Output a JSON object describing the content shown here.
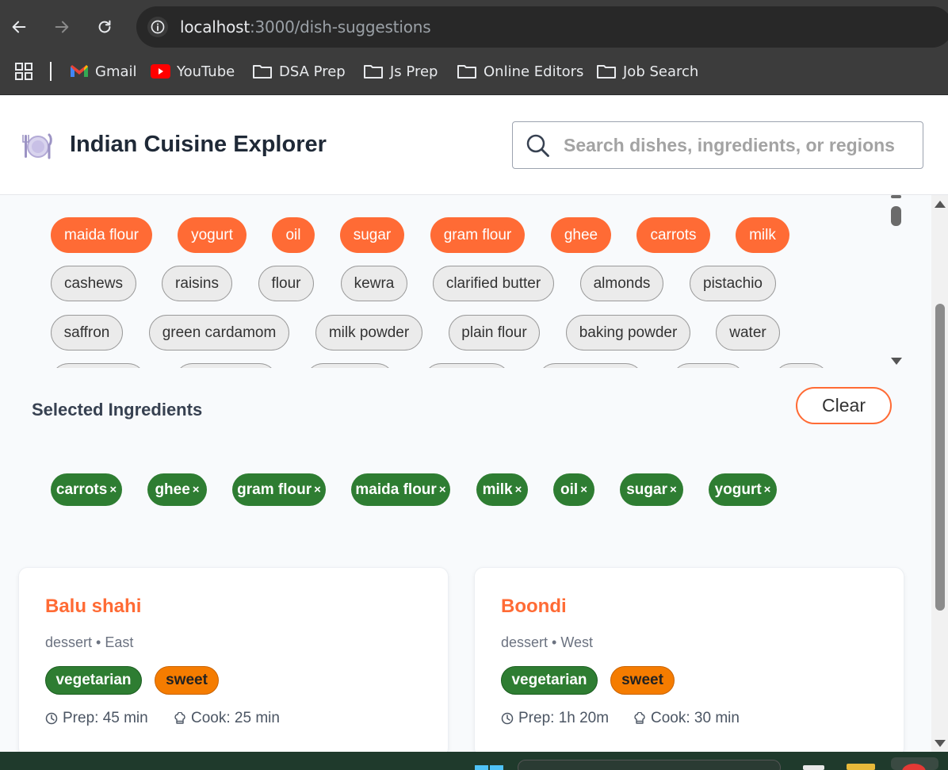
{
  "browser": {
    "url_host": "localhost",
    "url_path": ":3000/dish-suggestions",
    "bookmarks": [
      {
        "label": "Gmail",
        "icon": "gmail-icon"
      },
      {
        "label": "YouTube",
        "icon": "youtube-icon"
      },
      {
        "label": "DSA Prep",
        "icon": "folder-icon"
      },
      {
        "label": "Js Prep",
        "icon": "folder-icon"
      },
      {
        "label": "Online Editors",
        "icon": "folder-icon"
      },
      {
        "label": "Job Search",
        "icon": "folder-icon"
      }
    ]
  },
  "header": {
    "title": "Indian Cuisine Explorer",
    "logo_icon": "plate-cutlery-icon",
    "search_placeholder": "Search dishes, ingredients, or regions"
  },
  "ingredients": {
    "row1": [
      "maida flour",
      "yogurt",
      "oil",
      "sugar",
      "gram flour",
      "ghee",
      "carrots",
      "milk"
    ],
    "row2": [
      "cashews",
      "raisins",
      "flour",
      "kewra",
      "clarified butter",
      "almonds",
      "pistachio"
    ],
    "row3": [
      "saffron",
      "green cardamom",
      "milk powder",
      "plain flour",
      "baking powder",
      "water"
    ]
  },
  "selected": {
    "title": "Selected Ingredients",
    "clear_label": "Clear",
    "remove_symbol": "×",
    "tags": [
      "carrots",
      "ghee",
      "gram flour",
      "maida flour",
      "milk",
      "oil",
      "sugar",
      "yogurt"
    ]
  },
  "dishes": [
    {
      "name": "Balu shahi",
      "meta": "dessert • East",
      "badges": [
        "vegetarian",
        "sweet"
      ],
      "prep": "Prep: 45 min",
      "cook": "Cook: 25 min"
    },
    {
      "name": "Boondi",
      "meta": "dessert • West",
      "badges": [
        "vegetarian",
        "sweet"
      ],
      "prep": "Prep: 1h 20m",
      "cook": "Cook: 30 min"
    }
  ],
  "colors": {
    "accent": "#ff6b35",
    "selected_tag": "#2e7d32",
    "sweet_badge": "#f57c00"
  }
}
